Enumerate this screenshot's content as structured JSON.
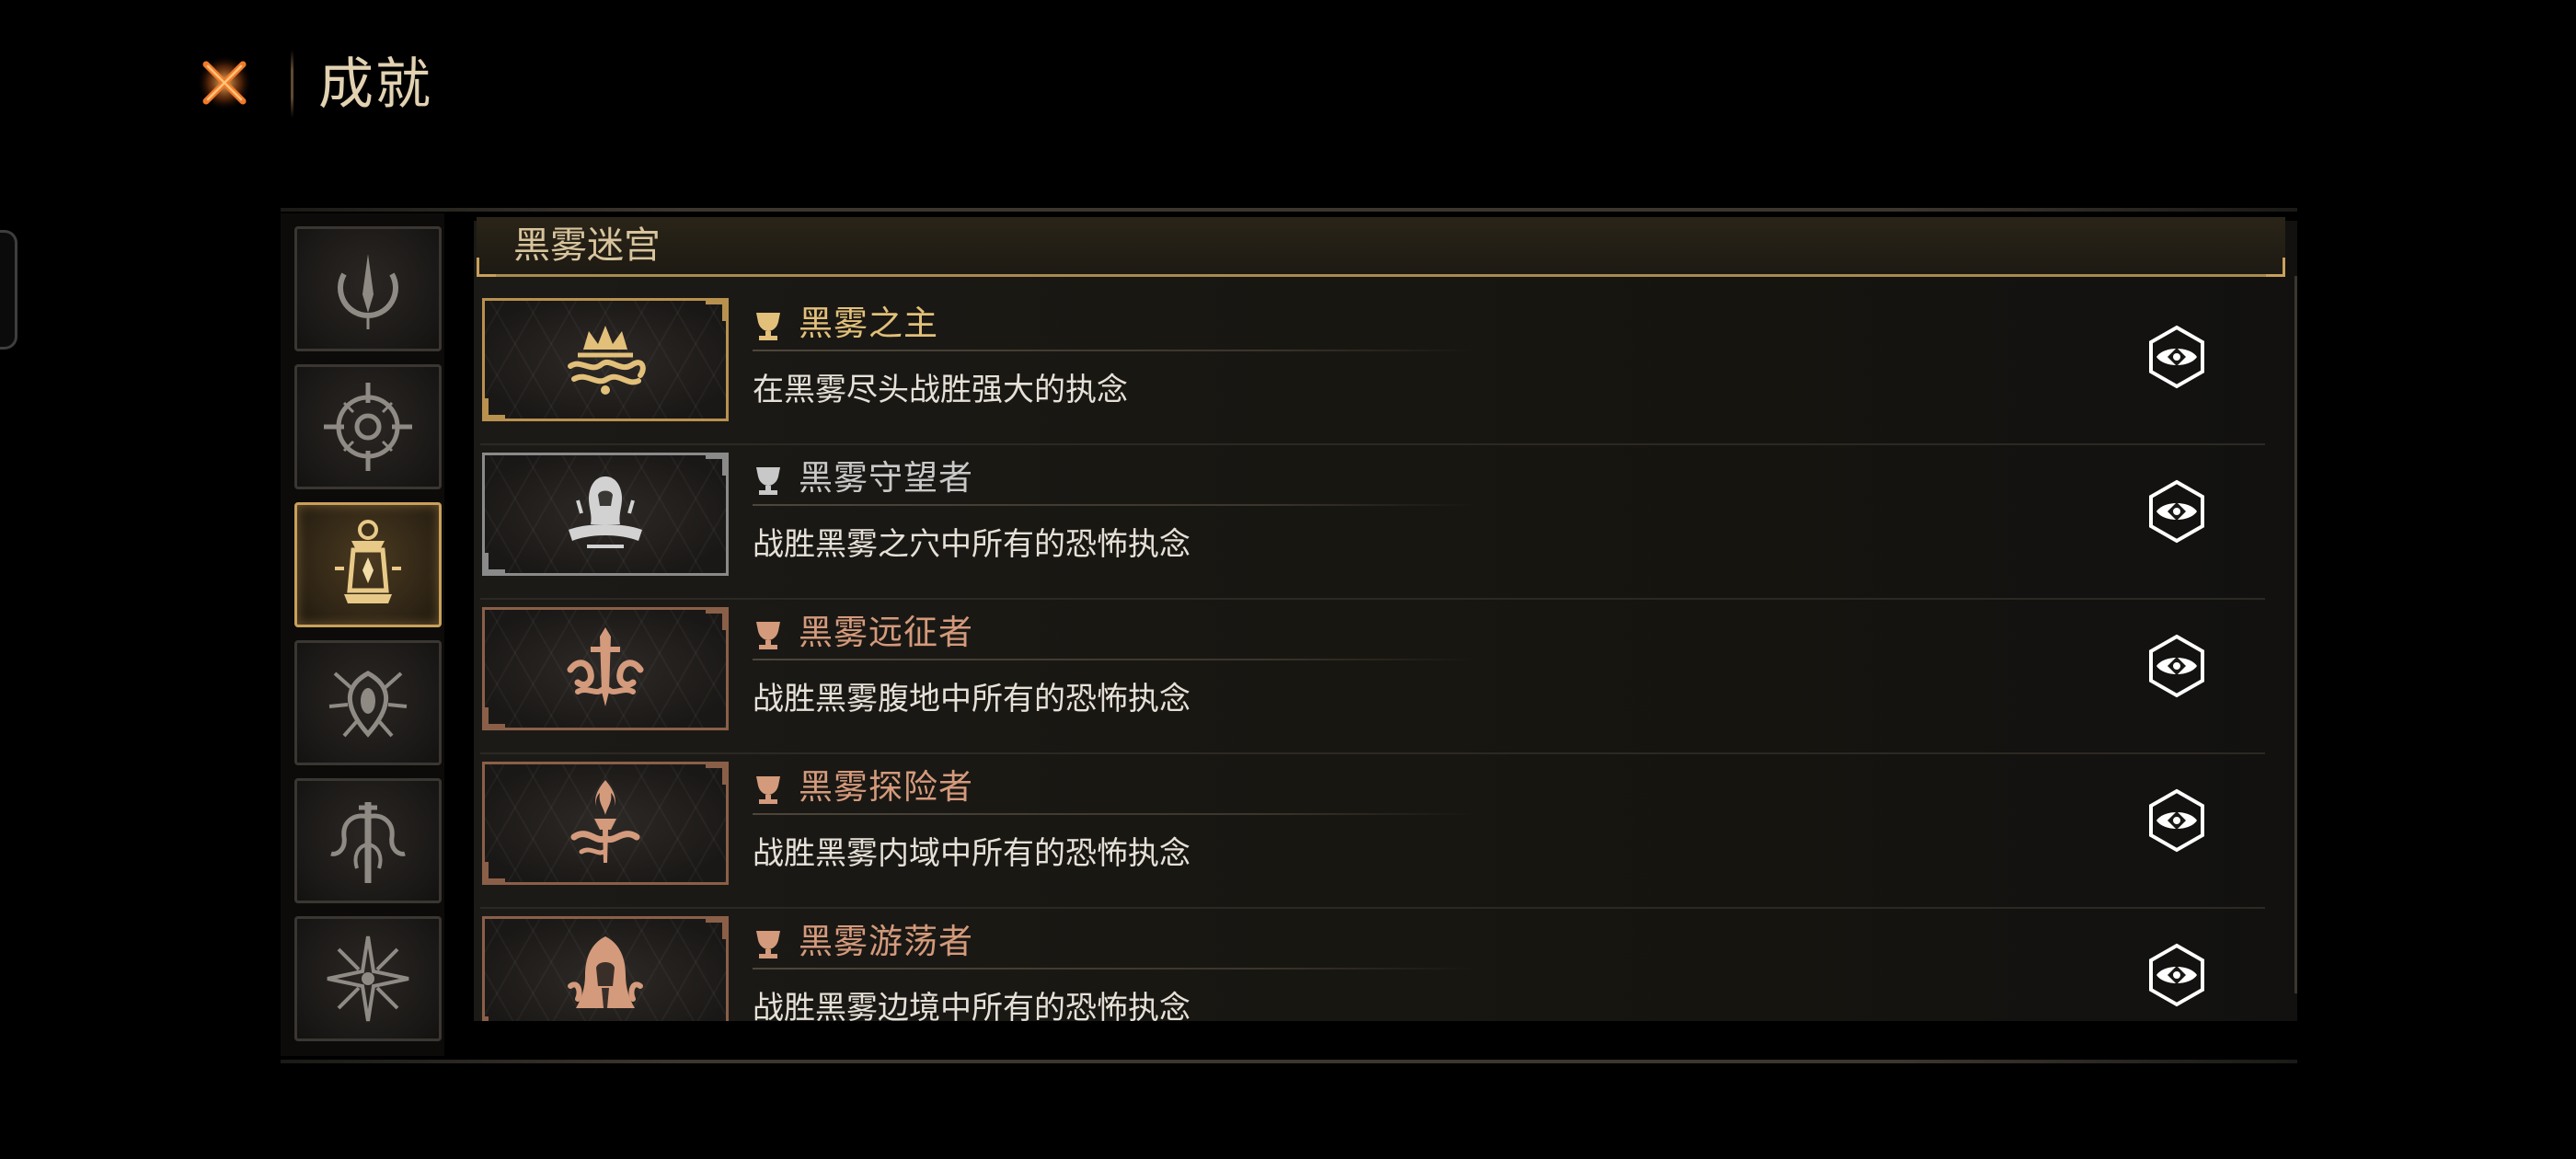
{
  "header": {
    "title": "成就",
    "close_icon": "close-x-icon"
  },
  "categories": [
    {
      "icon": "crescent-spire-icon",
      "active": false
    },
    {
      "icon": "compass-eye-icon",
      "active": false
    },
    {
      "icon": "lantern-icon",
      "active": true
    },
    {
      "icon": "thorned-eye-icon",
      "active": false
    },
    {
      "icon": "tentacle-totem-icon",
      "active": false
    },
    {
      "icon": "spiked-star-icon",
      "active": false
    }
  ],
  "section": {
    "title": "黑雾迷宫"
  },
  "achievements": [
    {
      "name": "黑雾之主",
      "description": "在黑雾尽头战胜强大的执念",
      "tier": "gold",
      "icon": "crown-mist-icon"
    },
    {
      "name": "黑雾守望者",
      "description": "战胜黑雾之穴中所有的恐怖执念",
      "tier": "silver",
      "icon": "hooded-watcher-icon"
    },
    {
      "name": "黑雾远征者",
      "description": "战胜黑雾腹地中所有的恐怖执念",
      "tier": "bronze",
      "icon": "sword-mist-icon"
    },
    {
      "name": "黑雾探险者",
      "description": "战胜黑雾内域中所有的恐怖执念",
      "tier": "bronze",
      "icon": "torch-icon"
    },
    {
      "name": "黑雾游荡者",
      "description": "战胜黑雾边境中所有的恐怖执念",
      "tier": "bronze",
      "icon": "hooded-wanderer-icon"
    }
  ],
  "colors": {
    "gold": "#e2c07a",
    "silver": "#c8c8c8",
    "bronze": "#d49a7c",
    "accent": "#c9a05a",
    "description": "#e6e1d8"
  }
}
